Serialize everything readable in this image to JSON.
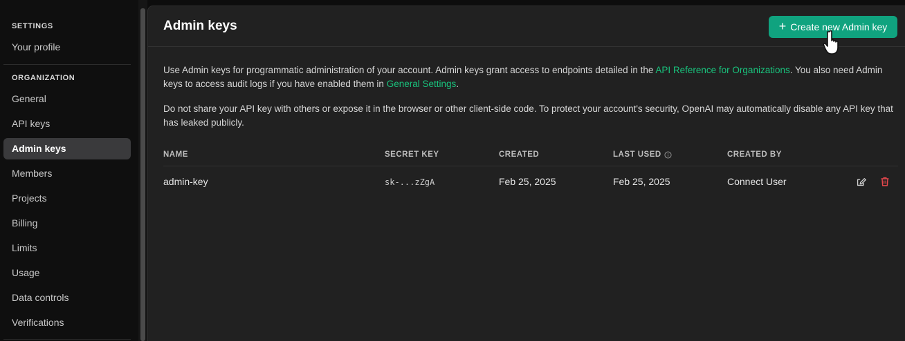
{
  "sidebar": {
    "settings_title": "SETTINGS",
    "your_profile": "Your profile",
    "organization_title": "ORGANIZATION",
    "items": [
      {
        "label": "General"
      },
      {
        "label": "API keys"
      },
      {
        "label": "Admin keys",
        "active": true
      },
      {
        "label": "Members"
      },
      {
        "label": "Projects"
      },
      {
        "label": "Billing"
      },
      {
        "label": "Limits"
      },
      {
        "label": "Usage"
      },
      {
        "label": "Data controls"
      },
      {
        "label": "Verifications"
      }
    ]
  },
  "main": {
    "title": "Admin keys",
    "create_button": "Create new Admin key",
    "intro": {
      "text1": "Use Admin keys for programmatic administration of your account. Admin keys grant access to endpoints detailed in the ",
      "link1": "API Reference for Organizations",
      "text2": ". You also need Admin keys to access audit logs if you have enabled them in ",
      "link2": "General Settings",
      "text3": "."
    },
    "warning": "Do not share your API key with others or expose it in the browser or other client-side code. To protect your account's security, OpenAI may automatically disable any API key that has leaked publicly.",
    "table": {
      "columns": {
        "name": "NAME",
        "secret_key": "SECRET KEY",
        "created": "CREATED",
        "last_used": "LAST USED",
        "created_by": "CREATED BY"
      },
      "rows": [
        {
          "name": "admin-key",
          "secret_key": "sk-...zZgA",
          "created": "Feb 25, 2025",
          "last_used": "Feb 25, 2025",
          "created_by": "Connect User"
        }
      ]
    }
  },
  "colors": {
    "accent": "#10a37f",
    "link": "#19c37d",
    "danger": "#e5484d"
  },
  "icons": [
    "plus-icon",
    "info-icon",
    "edit-icon",
    "trash-icon",
    "hand-pointer-cursor-icon"
  ]
}
